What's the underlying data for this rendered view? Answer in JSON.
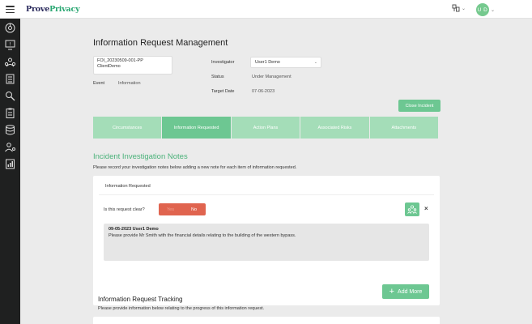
{
  "app": {
    "logo_main": "Prove",
    "logo_accent": "Privacy",
    "user_initials": "U D"
  },
  "page": {
    "title": "Information Request Management"
  },
  "record": {
    "ref_line1": "FOI_20230509-001-PP",
    "ref_line2": "ClientDemo",
    "event_label": "Event",
    "event_value": "Information",
    "investigator_label": "Investigator",
    "investigator_value": "User1 Demo",
    "status_label": "Status",
    "status_value": "Under Management",
    "target_label": "Target Date",
    "target_value": "07-06-2023"
  },
  "actions": {
    "close_incident": "Close Incident"
  },
  "tabs": [
    {
      "label": "Circumstances",
      "active": false
    },
    {
      "label": "Information Requested",
      "active": true
    },
    {
      "label": "Action Plans",
      "active": false
    },
    {
      "label": "Associated Risks",
      "active": false
    },
    {
      "label": "Attachments",
      "active": false
    }
  ],
  "notes": {
    "title": "Incident Investigation Notes",
    "description": "Please record your investigation notes below adding a new note for each item of information requested.",
    "card_label": "Information Requested",
    "question": "Is this request clear?",
    "toggle_yes": "Yes",
    "toggle_no": "No",
    "toggle_selected": "No",
    "remove_symbol": "×",
    "entry_meta": "09-05-2023 User1 Demo",
    "entry_text": "Please provide Mr Smith with the financial details relating to the building of the western bypass.",
    "add_more": "Add More"
  },
  "tracking": {
    "title": "Information Request Tracking",
    "description": "Please provide information below relating to the progress of this information request."
  },
  "colors": {
    "accent_green": "#6dc792",
    "tab_inactive": "#a4ddb8",
    "toggle_red": "#e0644f",
    "sidebar_bg": "#1f2020",
    "title_green": "#4bb27a"
  },
  "icons": {
    "sidebar": [
      "dashboard-icon",
      "screen-alert-icon",
      "people-network-icon",
      "building-icon",
      "search-person-icon",
      "clipboard-icon",
      "database-icon",
      "person-settings-icon",
      "report-chart-icon"
    ],
    "topbar": [
      "menu-icon",
      "organisation-icon",
      "chevron-down-icon"
    ]
  }
}
